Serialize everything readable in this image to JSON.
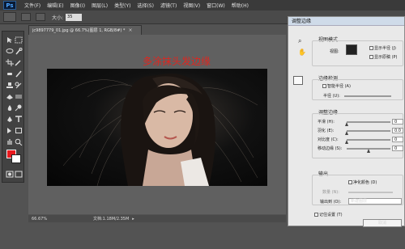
{
  "app": {
    "logo": "Ps"
  },
  "menu": [
    "文件(F)",
    "编辑(E)",
    "图像(I)",
    "图层(L)",
    "类型(Y)",
    "选择(S)",
    "滤镜(T)",
    "视图(V)",
    "窗口(W)",
    "帮助(H)"
  ],
  "options_bar": {
    "size_label": "大小:",
    "size_value": "35"
  },
  "document": {
    "tab_title": "jc9897779_01.jpg @ 66.7%(图层 1, RGB/8#) *",
    "tab_close": "×",
    "overlay_text": "多涂抹头发边缘"
  },
  "status": {
    "zoom": "66.67%",
    "doc_info": "文档:1.18M/2.35M",
    "arrow": "▸"
  },
  "colors": {
    "foreground": "#e8191e",
    "background": "#ffffff",
    "overlay_text": "#e0261f"
  },
  "dialog": {
    "title": "调整边缘",
    "view_mode": {
      "title": "视图模式",
      "view_label": "视图:",
      "show_radius": "显示半径 (J)",
      "show_original": "显示原稿 (P)"
    },
    "edge_detection": {
      "title": "边缘检测",
      "smart_radius": "智能半径 (A)",
      "radius_label": "半径 (U):"
    },
    "adjust_edge": {
      "title": "调整边缘",
      "sliders": [
        {
          "label": "平滑 (H):",
          "value": "0",
          "level": 0.0
        },
        {
          "label": "羽化 (E):",
          "value": "0.0",
          "level": 0.0
        },
        {
          "label": "对比度 (C):",
          "value": "0",
          "level": 0.0
        },
        {
          "label": "移动边缘 (S):",
          "value": "0",
          "level": 0.5
        }
      ]
    },
    "output": {
      "title": "输出",
      "decontaminate": "净化颜色 (D)",
      "amount_label": "数量 (N):",
      "output_to_label": "输出到 (O):",
      "output_to_value": "新建图层"
    },
    "remember": "记住设置 (T)",
    "cancel_label": "取消"
  }
}
